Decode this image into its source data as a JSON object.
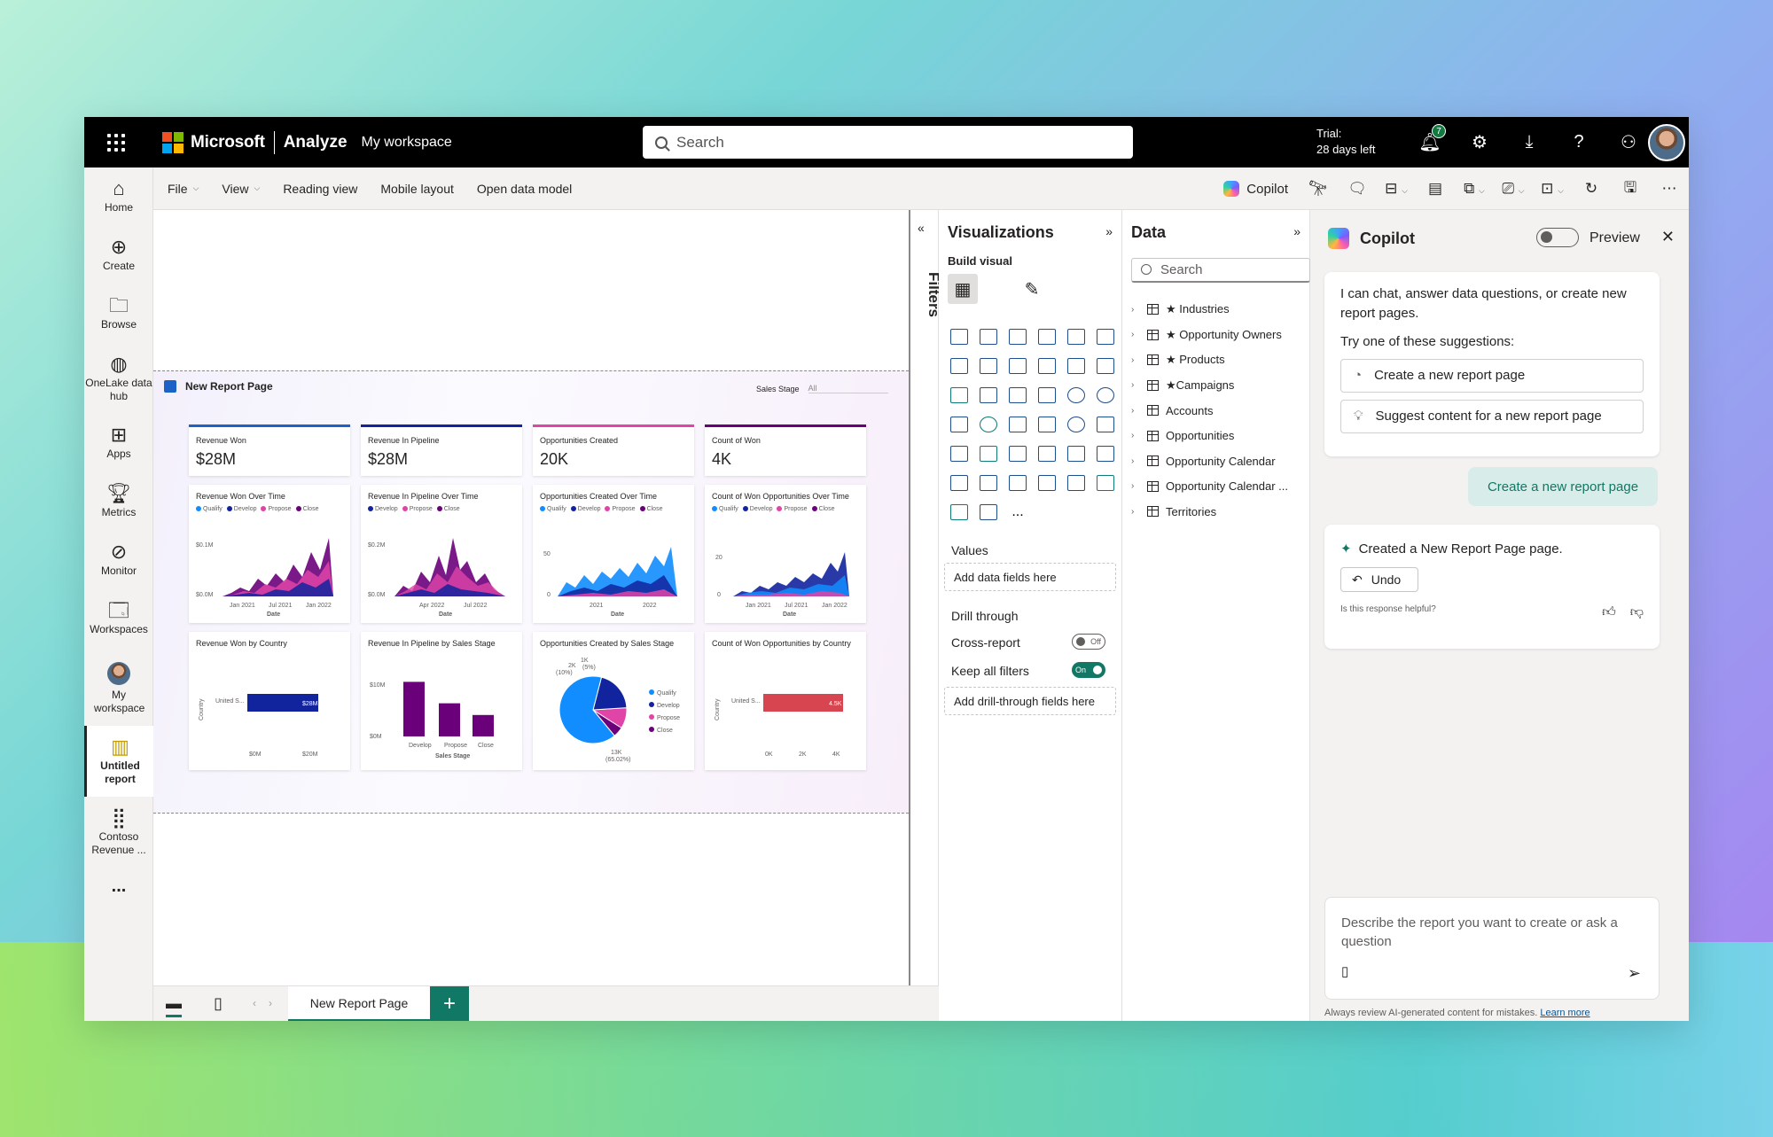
{
  "topbar": {
    "brand": "Microsoft",
    "app": "Analyze",
    "workspace": "My workspace",
    "search_placeholder": "Search",
    "trial_line1": "Trial:",
    "trial_line2": "28 days left",
    "notification_count": "7"
  },
  "nav": {
    "items": [
      {
        "label": "Home"
      },
      {
        "label": "Create"
      },
      {
        "label": "Browse"
      },
      {
        "label": "OneLake data hub"
      },
      {
        "label": "Apps"
      },
      {
        "label": "Metrics"
      },
      {
        "label": "Monitor"
      },
      {
        "label": "Workspaces"
      },
      {
        "label": "My workspace"
      },
      {
        "label": "Untitled report"
      },
      {
        "label": "Contoso Revenue ..."
      }
    ],
    "more": "..."
  },
  "ribbon": {
    "file": "File",
    "view": "View",
    "reading_view": "Reading view",
    "mobile_layout": "Mobile layout",
    "open_data_model": "Open data model",
    "copilot": "Copilot"
  },
  "report": {
    "page_title": "New Report Page",
    "slicer_label": "Sales Stage",
    "slicer_value": "All",
    "cards": [
      {
        "label": "Revenue Won",
        "value": "$28M"
      },
      {
        "label": "Revenue In Pipeline",
        "value": "$28M"
      },
      {
        "label": "Opportunities Created",
        "value": "20K"
      },
      {
        "label": "Count of Won",
        "value": "4K"
      }
    ],
    "line_charts": [
      {
        "title": "Revenue Won Over Time",
        "legend": [
          "Qualify",
          "Develop",
          "Propose",
          "Close"
        ],
        "y_ticks": [
          "$0.1M",
          "$0.0M"
        ],
        "x_ticks": [
          "Jan 2021",
          "Jul 2021",
          "Jan 2022"
        ],
        "xlabel": "Date"
      },
      {
        "title": "Revenue In Pipeline Over Time",
        "legend": [
          "Develop",
          "Propose",
          "Close"
        ],
        "y_ticks": [
          "$0.2M",
          "$0.0M"
        ],
        "x_ticks": [
          "Apr 2022",
          "Jul 2022"
        ],
        "xlabel": "Date"
      },
      {
        "title": "Opportunities Created Over Time",
        "legend": [
          "Qualify",
          "Develop",
          "Propose",
          "Close"
        ],
        "y_ticks": [
          "50",
          "0"
        ],
        "x_ticks": [
          "2021",
          "2022"
        ],
        "xlabel": "Date"
      },
      {
        "title": "Count of Won Opportunities Over Time",
        "legend": [
          "Qualify",
          "Develop",
          "Propose",
          "Close"
        ],
        "y_ticks": [
          "20",
          "0"
        ],
        "x_ticks": [
          "Jan 2021",
          "Jul 2021",
          "Jan 2022"
        ],
        "xlabel": "Date"
      }
    ],
    "country_chart_1": {
      "title": "Revenue Won by Country",
      "ylabel": "Country",
      "category": "United S...",
      "data_label": "$28M",
      "x_ticks": [
        "$0M",
        "$20M"
      ]
    },
    "stage_chart": {
      "title": "Revenue In Pipeline by Sales Stage",
      "y_ticks": [
        "$10M",
        "$0M"
      ],
      "categories": [
        "Develop",
        "Propose",
        "Close"
      ],
      "xlabel": "Sales Stage"
    },
    "pie_chart": {
      "title": "Opportunities Created by Sales Stage",
      "label_small": "2K",
      "label_small_pct": "(10%)",
      "label_tiny": "1K",
      "label_tiny_pct": "(5%)",
      "label_big": "13K",
      "label_big_pct": "(65.02%)",
      "legend": [
        "Qualify",
        "Develop",
        "Propose",
        "Close"
      ]
    },
    "country_chart_2": {
      "title": "Count of Won Opportunities by Country",
      "ylabel": "Country",
      "category": "United S...",
      "data_label": "4.5K",
      "x_ticks": [
        "0K",
        "2K",
        "4K"
      ]
    }
  },
  "chart_data": [
    {
      "type": "bar",
      "title": "Revenue In Pipeline by Sales Stage",
      "categories": [
        "Develop",
        "Propose",
        "Close"
      ],
      "values": [
        14,
        8.5,
        5.5
      ],
      "xlabel": "Sales Stage",
      "ylabel": "",
      "ylim": [
        0,
        15
      ]
    },
    {
      "type": "pie",
      "title": "Opportunities Created by Sales Stage",
      "categories": [
        "Qualify",
        "Develop",
        "Propose",
        "Close"
      ],
      "values": [
        65.02,
        20,
        10,
        5
      ]
    }
  ],
  "filters": {
    "label": "Filters",
    "collapse": "«"
  },
  "viz_pane": {
    "title": "Visualizations",
    "build_visual": "Build visual",
    "more": "...",
    "values_label": "Values",
    "values_drop": "Add data fields here",
    "drill_label": "Drill through",
    "cross_report": "Cross-report",
    "cross_report_state": "Off",
    "keep_filters": "Keep all filters",
    "keep_filters_state": "On",
    "drill_drop": "Add drill-through fields here"
  },
  "data_pane": {
    "title": "Data",
    "search_placeholder": "Search",
    "tables": [
      "★ Industries",
      "★ Opportunity Owners",
      "★ Products",
      "★Campaigns",
      "Accounts",
      "Opportunities",
      "Opportunity Calendar",
      "Opportunity Calendar ...",
      "Territories"
    ]
  },
  "copilot_pane": {
    "title": "Copilot",
    "preview": "Preview",
    "intro": "I can chat, answer data questions, or create new report pages.",
    "try": "Try one of these suggestions:",
    "suggestions": [
      "Create a new report page",
      "Suggest content for a new report page"
    ],
    "user_message": "Create a new report page",
    "response": "Created a New Report Page page.",
    "undo": "Undo",
    "helpful": "Is this response helpful?",
    "input_placeholder": "Describe the report you want to create or ask a question",
    "disclaimer": "Always review AI-generated content for mistakes.",
    "learn_more": "Learn more"
  },
  "pagebar": {
    "tab": "New Report Page",
    "add": "+"
  },
  "colors": {
    "accent": "#117865",
    "series_qualify": "#118dff",
    "series_develop": "#12239e",
    "series_propose": "#e044a7",
    "series_close": "#6b007b"
  }
}
